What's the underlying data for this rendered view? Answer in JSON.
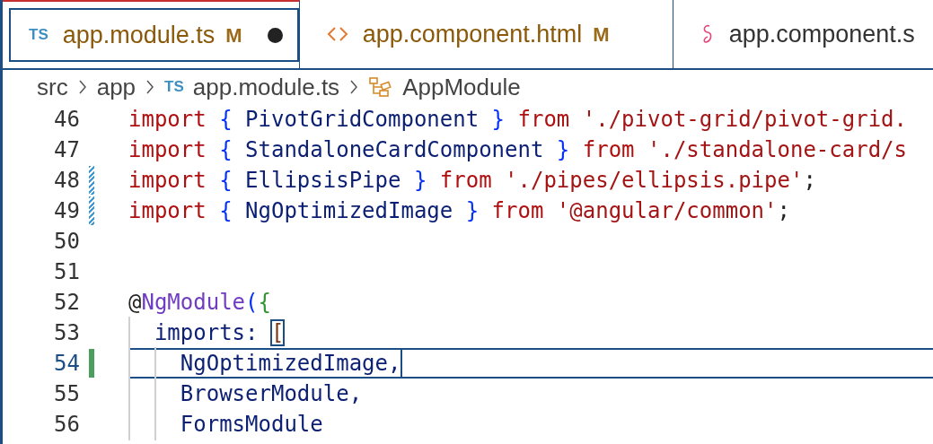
{
  "tabs": [
    {
      "kind": "ts",
      "icon_text": "TS",
      "label": "app.module.ts",
      "git_status": "M",
      "dirty": true,
      "selected": true
    },
    {
      "kind": "html",
      "label": "app.component.html",
      "git_status": "M",
      "dirty": false,
      "selected": false
    },
    {
      "kind": "scss",
      "label": "app.component.s",
      "dirty": false,
      "selected": false
    }
  ],
  "breadcrumb": [
    {
      "kind": "folder",
      "label": "src"
    },
    {
      "kind": "folder",
      "label": "app"
    },
    {
      "kind": "file",
      "icon_text": "TS",
      "label": "app.module.ts"
    },
    {
      "kind": "symbol",
      "label": "AppModule"
    }
  ],
  "code_lines": [
    {
      "number": "46",
      "modified": false,
      "added": false,
      "current": false,
      "tokens": [
        {
          "kind": "keyword",
          "text": "import "
        },
        {
          "kind": "brace",
          "text": "{"
        },
        {
          "kind": "ident",
          "text": " PivotGridComponent "
        },
        {
          "kind": "brace",
          "text": "}"
        },
        {
          "kind": "keyword",
          "text": " from "
        },
        {
          "kind": "string",
          "text": "'./pivot-grid/pivot-grid."
        }
      ]
    },
    {
      "number": "47",
      "modified": false,
      "added": false,
      "current": false,
      "tokens": [
        {
          "kind": "keyword",
          "text": "import "
        },
        {
          "kind": "brace",
          "text": "{"
        },
        {
          "kind": "ident",
          "text": " StandaloneCardComponent "
        },
        {
          "kind": "brace",
          "text": "}"
        },
        {
          "kind": "keyword",
          "text": " from "
        },
        {
          "kind": "string",
          "text": "'./standalone-card/s"
        }
      ]
    },
    {
      "number": "48",
      "modified": true,
      "added": false,
      "current": false,
      "tokens": [
        {
          "kind": "keyword",
          "text": "import "
        },
        {
          "kind": "brace",
          "text": "{"
        },
        {
          "kind": "ident",
          "text": " EllipsisPipe "
        },
        {
          "kind": "brace",
          "text": "}"
        },
        {
          "kind": "keyword",
          "text": " from "
        },
        {
          "kind": "string",
          "text": "'./pipes/ellipsis.pipe'"
        },
        {
          "kind": "plain",
          "text": ";"
        }
      ]
    },
    {
      "number": "49",
      "modified": true,
      "added": false,
      "current": false,
      "tokens": [
        {
          "kind": "keyword",
          "text": "import "
        },
        {
          "kind": "brace",
          "text": "{"
        },
        {
          "kind": "ident",
          "text": " NgOptimizedImage "
        },
        {
          "kind": "brace",
          "text": "}"
        },
        {
          "kind": "keyword",
          "text": " from "
        },
        {
          "kind": "string",
          "text": "'@angular/common'"
        },
        {
          "kind": "plain",
          "text": ";"
        }
      ]
    },
    {
      "number": "50",
      "modified": false,
      "added": false,
      "current": false
    },
    {
      "number": "51",
      "modified": false,
      "added": false,
      "current": false
    },
    {
      "number": "52",
      "modified": false,
      "added": false,
      "current": false,
      "tokens": [
        {
          "kind": "plain",
          "text": "@"
        },
        {
          "kind": "decorator",
          "text": "NgModule"
        },
        {
          "kind": "brace",
          "text": "("
        },
        {
          "kind": "brace2",
          "text": "{"
        }
      ]
    },
    {
      "number": "53",
      "modified": false,
      "added": false,
      "current": false,
      "tokens": [
        {
          "kind": "ident",
          "text": "  imports: "
        },
        {
          "kind": "bracket_match",
          "text": "["
        }
      ]
    },
    {
      "number": "54",
      "modified": false,
      "added": true,
      "current": true,
      "tokens": [
        {
          "kind": "ident",
          "text": "    NgOptimizedImage,"
        }
      ]
    },
    {
      "number": "55",
      "modified": false,
      "added": false,
      "current": false,
      "tokens": [
        {
          "kind": "ident",
          "text": "    BrowserModule,"
        }
      ]
    },
    {
      "number": "56",
      "modified": false,
      "added": false,
      "current": false,
      "tokens": [
        {
          "kind": "ident",
          "text": "    FormsModule"
        }
      ]
    }
  ]
}
